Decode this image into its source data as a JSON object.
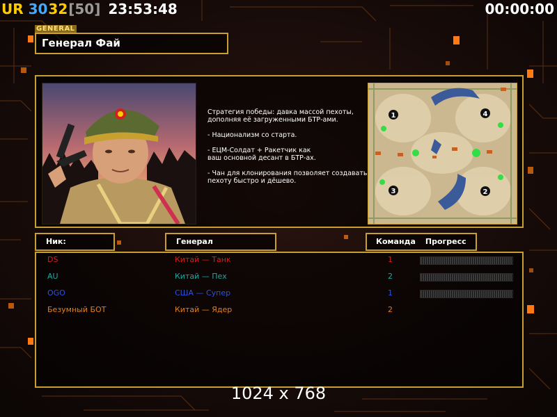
{
  "hud": {
    "ur": "UR",
    "n1": "30",
    "n2": "32",
    "n3": "[50]",
    "time": "23:53:48",
    "timer": "00:00:00"
  },
  "general": {
    "tag": "GENERAL",
    "name": "Генерал Фай"
  },
  "strategy": [
    "Стратегия победы: давка массой пехоты,\n дополняя её загруженными БТР-ами.",
    "- Национализм со старта.",
    "- ЕЦМ-Солдат + Ракетчик как\nваш основной десант в БТР-ах.",
    "- Чан для клонирования позволяет создавать\n пехоту быстро и дёшево."
  ],
  "map": {
    "spots": [
      "1",
      "4",
      "3",
      "2"
    ]
  },
  "headers": {
    "nick": "Ник:",
    "general": "Генерал",
    "team": "Команда",
    "progress": "Прогресс"
  },
  "players": [
    {
      "nick": "DS",
      "general": "Китай — Танк",
      "team": "1",
      "color": "#d02020",
      "progress": true
    },
    {
      "nick": "AU",
      "general": "Китай — Пех",
      "team": "2",
      "color": "#20a8a0",
      "progress": true
    },
    {
      "nick": "OGO",
      "general": "США — Супер",
      "team": "1",
      "color": "#3050e0",
      "progress": true
    },
    {
      "nick": "Безумный БОТ",
      "general": "Китай — Ядер",
      "team": "2",
      "color": "#e08020",
      "progress": false
    }
  ],
  "colors": {
    "frame": "#c8a030",
    "ur": "#ffcc00",
    "n1": "#44aaff",
    "n2": "#ffcc00",
    "n3": "#9a9a9a"
  },
  "resolution": "1024 x 768"
}
